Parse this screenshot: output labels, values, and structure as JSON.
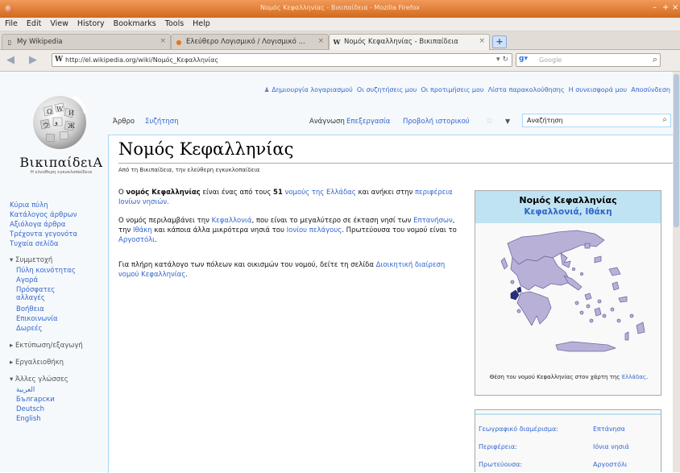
{
  "window": {
    "title": "Νομός Κεφαλληνίας - Βικιπαίδεια - Mozilla Firefox"
  },
  "menu": [
    "File",
    "Edit",
    "View",
    "History",
    "Bookmarks",
    "Tools",
    "Help"
  ],
  "tabs": [
    {
      "label": "My Wikipedia",
      "favicon": "page"
    },
    {
      "label": "Ελεύθερο Λογισμικό / Λογισμικό ...",
      "favicon": "firefox"
    },
    {
      "label": "Νομός Κεφαλληνίας - Βικιπαίδεια",
      "favicon": "W"
    }
  ],
  "address": {
    "url": "http://el.wikipedia.org/wiki/Νομός_Κεφαλληνίας"
  },
  "search": {
    "engine": "Google",
    "placeholder": "Google"
  },
  "personal": [
    "Δημιουργία λογαριασμού",
    "Οι συζητήσεις μου",
    "Οι προτιμήσεις μου",
    "Λίστα παρακολούθησης",
    "Η συνεισφορά μου",
    "Αποσύνδεση"
  ],
  "logo": {
    "title": "ΒικιπαίδειΑ",
    "subtitle": "Η ελεύθερη εγκυκλοπαίδεια"
  },
  "sidebar": {
    "main": [
      "Κύρια πύλη",
      "Κατάλογος άρθρων",
      "Αξιόλογα άρθρα",
      "Τρέχοντα γεγονότα",
      "Τυχαία σελίδα"
    ],
    "interaction_head": "Συμμετοχή",
    "interaction": [
      "Πύλη κοινότητας",
      "Αγορά",
      "Πρόσφατες αλλαγές",
      "Βοήθεια",
      "Επικοινωνία",
      "Δωρεές"
    ],
    "print_head": "Εκτύπωση/εξαγωγή",
    "tools_head": "Εργαλειοθήκη",
    "lang_head": "Άλλες γλώσσες",
    "languages": [
      "العربية",
      "Български",
      "Deutsch",
      "English"
    ]
  },
  "pagetabs": {
    "article": "Άρθρο",
    "talk": "Συζήτηση",
    "read": "Ανάγνωση",
    "edit": "Επεξεργασία",
    "history": "Προβολή ιστορικού",
    "search_value": "Αναζήτηση"
  },
  "article": {
    "title": "Νομός Κεφαλληνίας",
    "from": "Από τη Βικιπαίδεια, την ελεύθερη εγκυκλοπαίδεια",
    "p1_bold_pre": "Ο ",
    "p1_bold": "νομός Κεφαλληνίας",
    "p1_text": " είναι ένας από τους ",
    "p1_num": "51",
    "p1_link1": "νομούς",
    "p1_link2": "της Ελλάδας",
    "p1_end": " και ανήκει στην ",
    "p1_link3": "περιφέρεια Ιονίων νησιών.",
    "p2_start": "Ο νομός περιλαμβάνει την ",
    "p2_link1": "Κεφαλλονιά",
    "p2_mid1": ", που είναι το μεγαλύτερο σε έκταση νησί των ",
    "p2_link2": "Επτανήσων",
    "p2_mid2": ", την ",
    "p2_link3": "Ιθάκη",
    "p2_mid3": " και κάποια άλλα μικρότερα νησιά του ",
    "p2_link4": "Ιονίου πελάγους",
    "p2_mid4": ". Πρωτεύουσα του νομού είναι το ",
    "p2_link5": "Αργοστόλι",
    "p2_end": ".",
    "p3_text": "Για πλήρη κατάλογο των πόλεων και οικισμών του νομού, δείτε τη σελίδα ",
    "p3_link": "Διοικητική διαίρεση νομού Κεφαλληνίας",
    "p3_end": "."
  },
  "infobox": {
    "title": "Νομός Κεφαλληνίας",
    "subtitle": "Κεφαλλονιά, Ιθάκη",
    "caption_pre": "Θέση του νομού Κεφαλληνίας στον χάρτη της ",
    "caption_link": "Ελλάδας",
    "caption_end": ".",
    "rows": [
      {
        "label": "Γεωγραφικό διαμέρισμα:",
        "value": "Επτάνησα"
      },
      {
        "label": "Περιφέρεια:",
        "value": "Ιόνια νησιά"
      },
      {
        "label": "Πρωτεύουσα:",
        "value": "Αργοστόλι"
      }
    ],
    "colors": {
      "map_fill": "#b9b0d8",
      "map_stroke": "#6f6aa0",
      "highlight": "#2b2f7a"
    }
  }
}
